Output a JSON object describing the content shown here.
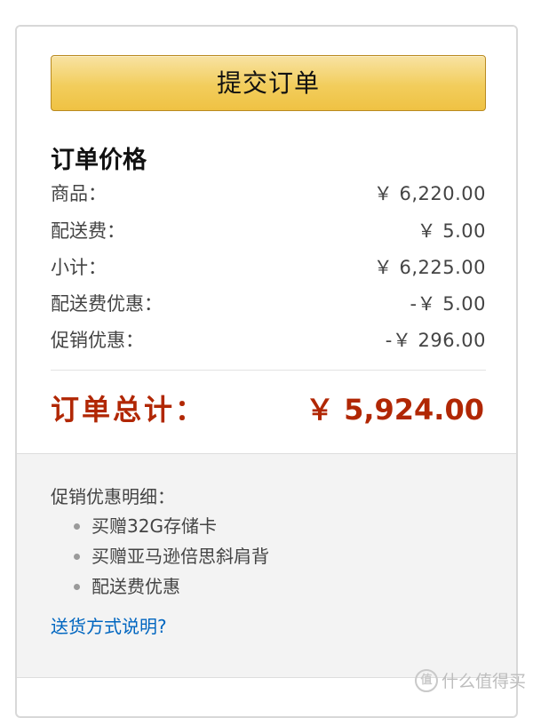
{
  "submit": {
    "label": "提交订单"
  },
  "summary": {
    "title": "订单价格",
    "rows": [
      {
        "label": "商品：",
        "value": "￥ 6,220.00"
      },
      {
        "label": "配送费：",
        "value": "￥ 5.00"
      },
      {
        "label": "小计：",
        "value": "￥ 6,225.00"
      },
      {
        "label": "配送费优惠：",
        "value": "-￥ 5.00"
      },
      {
        "label": "促销优惠：",
        "value": "-￥ 296.00"
      }
    ],
    "total_label": "订单总计：",
    "total_value": "￥ 5,924.00",
    "total_color": "#b12704"
  },
  "promotions": {
    "title": "促销优惠明细：",
    "items": [
      "买赠32G存储卡",
      "买赠亚马逊倍思斜肩背",
      "配送费优惠"
    ]
  },
  "shipping_link": "送货方式说明?",
  "watermark": {
    "badge": "值",
    "text": "什么值得买"
  },
  "colors": {
    "button": "#f2cd5c",
    "link": "#0066c0"
  }
}
